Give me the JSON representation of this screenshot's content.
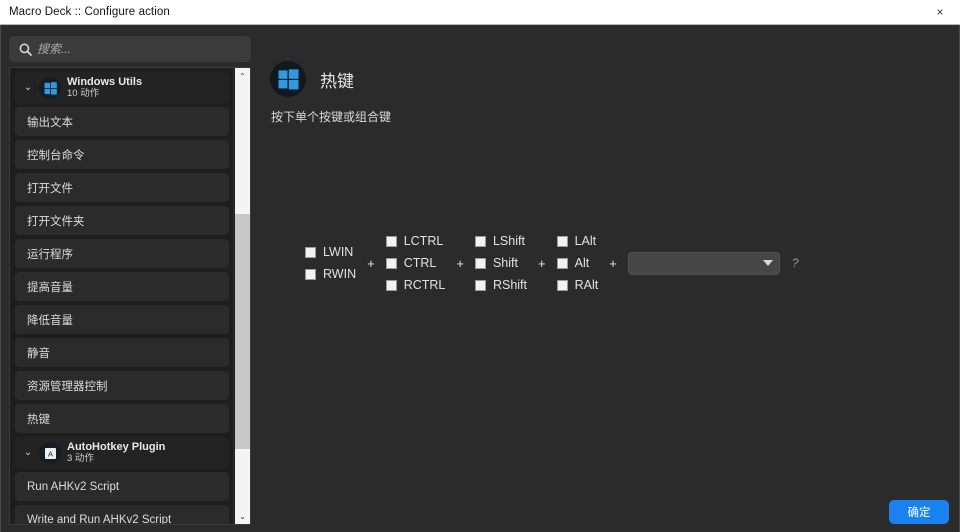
{
  "window": {
    "title": "Macro Deck :: Configure action",
    "close_label": "×",
    "close_icon": "close-icon"
  },
  "sidebar": {
    "search": {
      "placeholder": "搜索...",
      "value": "",
      "icon": "search-icon"
    },
    "groups": [
      {
        "title": "Windows Utils",
        "subtitle": "10 动作",
        "icon": "windows-logo-icon",
        "chevron": "⌄",
        "expanded": true,
        "actions": [
          "输出文本",
          "控制台命令",
          "打开文件",
          "打开文件夹",
          "运行程序",
          "提高音量",
          "降低音量",
          "静音",
          "资源管理器控制",
          "热键"
        ]
      },
      {
        "title": "AutoHotkey Plugin",
        "subtitle": "3 动作",
        "icon": "autohotkey-icon",
        "chevron": "⌄",
        "expanded": true,
        "actions": [
          "Run AHKv2 Script",
          "Write and Run AHKv2 Script"
        ]
      }
    ],
    "scrollbar": {
      "up_arrow": "⌃",
      "down_arrow": "⌄"
    }
  },
  "main": {
    "action_icon": "windows-logo-icon",
    "action_title": "热键",
    "subtitle": "按下单个按键或组合键",
    "key_columns": [
      {
        "keys": [
          "LWIN",
          "RWIN"
        ]
      },
      {
        "keys": [
          "LCTRL",
          "CTRL",
          "RCTRL"
        ]
      },
      {
        "keys": [
          "LShift",
          "Shift",
          "RShift"
        ]
      },
      {
        "keys": [
          "LAlt",
          "Alt",
          "RAlt"
        ]
      }
    ],
    "separator": "+",
    "key_select": {
      "value": "",
      "caret_icon": "chevron-down-icon"
    },
    "help_marker": "?"
  },
  "footer": {
    "confirm_label": "确定"
  },
  "colors": {
    "accent": "#1782f0",
    "window_bg": "#2b2b2b",
    "list_bg": "#1e1e1e",
    "row_bg": "#2b2b2b",
    "group_bg": "#232323",
    "titlebar_bg": "#ffffff"
  }
}
